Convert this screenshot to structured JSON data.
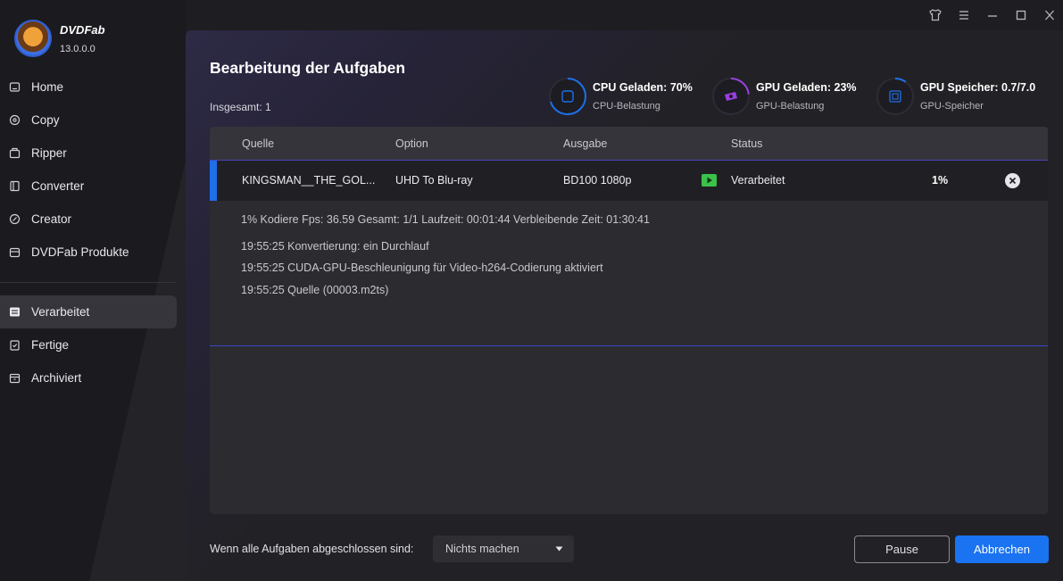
{
  "app": {
    "name": "DVDFab",
    "version": "13.0.0.0"
  },
  "sidebar": {
    "items": [
      {
        "label": "Home",
        "icon": "home-icon"
      },
      {
        "label": "Copy",
        "icon": "copy-icon"
      },
      {
        "label": "Ripper",
        "icon": "ripper-icon"
      },
      {
        "label": "Converter",
        "icon": "converter-icon"
      },
      {
        "label": "Creator",
        "icon": "creator-icon"
      },
      {
        "label": "DVDFab Produkte",
        "icon": "products-icon"
      }
    ],
    "queue_items": [
      {
        "label": "Verarbeitet",
        "icon": "processing-icon",
        "active": true
      },
      {
        "label": "Fertige",
        "icon": "finished-icon"
      },
      {
        "label": "Archiviert",
        "icon": "archive-icon"
      }
    ]
  },
  "titlebar": {
    "icons": [
      "skin-icon",
      "menu-icon",
      "minimize-icon",
      "maximize-icon",
      "close-icon"
    ]
  },
  "main": {
    "title": "Bearbeitung der Aufgaben",
    "total": "Insgesamt: 1",
    "stats": [
      {
        "title": "CPU Geladen: 70%",
        "sub": "CPU-Belastung",
        "icon": "cpu-icon",
        "value": 0.7,
        "color": "#1e6fe8"
      },
      {
        "title": "GPU Geladen: 23%",
        "sub": "GPU-Belastung",
        "icon": "gpu-icon",
        "value": 0.23,
        "color": "#9b3fe0"
      },
      {
        "title": "GPU Speicher: 0.7/7.0",
        "sub": "GPU-Speicher",
        "icon": "gpu-memory-icon",
        "value": 0.1,
        "color": "#1e6fe8"
      }
    ]
  },
  "table": {
    "headers": [
      "Quelle",
      "Option",
      "Ausgabe",
      "Status"
    ],
    "row": {
      "source": "KINGSMAN__THE_GOL...",
      "option": "UHD To Blu-ray",
      "output": "BD100 1080p",
      "status": "Verarbeitet",
      "progress": "1%"
    },
    "details": [
      "1%  Kodiere Fps: 36.59  Gesamt: 1/1  Laufzeit: 00:01:44  Verbleibende Zeit: 01:30:41",
      "19:55:25  Konvertierung: ein Durchlauf",
      "19:55:25  CUDA-GPU-Beschleunigung für Video-h264-Codierung aktiviert",
      "19:55:25  Quelle (00003.m2ts)"
    ]
  },
  "footer": {
    "label": "Wenn alle Aufgaben abgeschlossen sind:",
    "select_value": "Nichts machen",
    "pause": "Pause",
    "cancel": "Abbrechen"
  },
  "colors": {
    "accent": "#1a73f0",
    "status_green": "#3ac24a",
    "gpu_purple": "#9b3fe0"
  }
}
